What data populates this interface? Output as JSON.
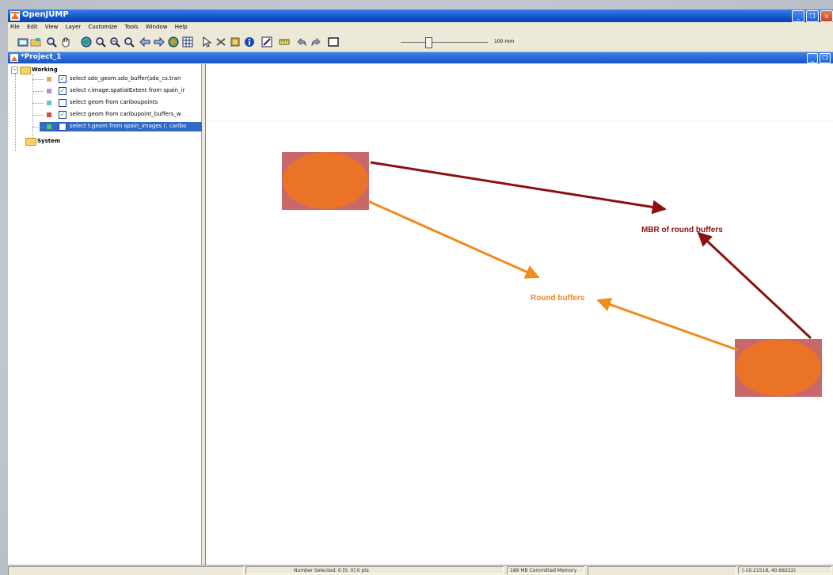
{
  "window": {
    "title": "OpenJUMP",
    "controls": [
      "minimize",
      "maximize",
      "close"
    ]
  },
  "menubar": {
    "items": [
      "File",
      "Edit",
      "View",
      "Layer",
      "Customize",
      "Tools",
      "Window",
      "Help"
    ]
  },
  "toolbar": {
    "icons": [
      "new-project-icon",
      "open-icon",
      "zoom-icon",
      "pan-icon",
      "zoom-full-icon",
      "zoom-in-icon",
      "zoom-out-icon",
      "zoom-to-selected-icon",
      "zoom-previous-icon",
      "zoom-next-icon",
      "zoom-to-layer-icon",
      "grid-icon",
      "select-icon",
      "delete-icon",
      "feature-info-icon",
      "info-icon",
      "edit-icon",
      "measure-icon",
      "undo-icon",
      "redo-icon",
      "rectangle-icon"
    ],
    "zoom_label": "100 mm",
    "zoom_level": 0.3
  },
  "project": {
    "title": "*Project_1"
  },
  "tree": {
    "categories": [
      {
        "label": "Working",
        "expanded": true
      },
      {
        "label": "System",
        "expanded": false
      }
    ],
    "layers": [
      {
        "label": "select sdo_geom.sdo_buffer(sdo_cs.tran",
        "color": "#f0a060",
        "checked": true,
        "selected": false
      },
      {
        "label": "select r.image.spatialExtent from spain_ir",
        "color": "#c08ad0",
        "checked": true,
        "selected": false
      },
      {
        "label": "select geom from cariboupoints",
        "color": "#5cc8c8",
        "checked": false,
        "selected": false
      },
      {
        "label": "select geom from caribupoint_buffers_w",
        "color": "#d05050",
        "checked": true,
        "selected": false
      },
      {
        "label": "select t.geom from spain_images r, caribo",
        "color": "#58c858",
        "checked": false,
        "selected": true
      }
    ]
  },
  "map": {
    "annotations": {
      "mbr_label": "MBR of round buffers",
      "round_label": "Round buffers"
    },
    "colors": {
      "mbr_fill": "#c8686a",
      "buffer_fill": "#ea7328",
      "mbr_arrow": "#8b1010",
      "round_arrow": "#f28a1e"
    }
  },
  "status": {
    "selection": "Number Selected: 0 [0, 0] 0 pts",
    "memory": "189 MB Committed Memory",
    "coordinates": "(-10.21518, 40.68222)"
  }
}
